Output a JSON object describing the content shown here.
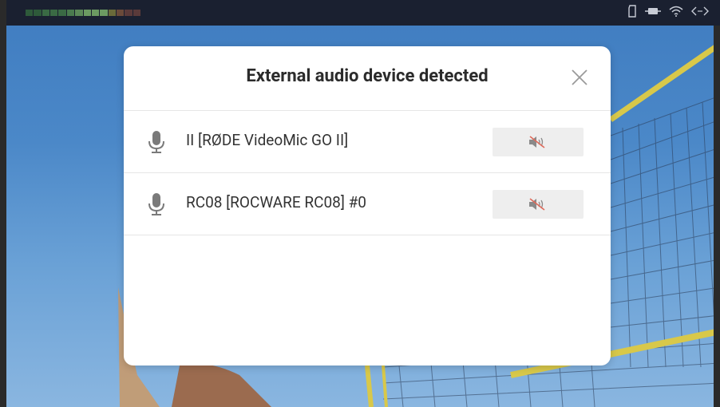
{
  "dialog": {
    "title": "External audio device detected",
    "close_icon": "close-icon"
  },
  "devices": [
    {
      "name": "II [RØDE VideoMic GO II]",
      "icon": "microphone-icon",
      "mute_icon": "speaker-muted-icon"
    },
    {
      "name": "RC08 [ROCWARE RC08] #0",
      "icon": "microphone-icon",
      "mute_icon": "speaker-muted-icon"
    }
  ],
  "status_bar": {
    "icons": [
      "sd-card-icon",
      "battery-plug-icon",
      "wifi-icon",
      "code-brackets-icon"
    ]
  },
  "colors": {
    "mute_icon_red": "#e06a5a",
    "accent_background": "#4b88c8"
  }
}
